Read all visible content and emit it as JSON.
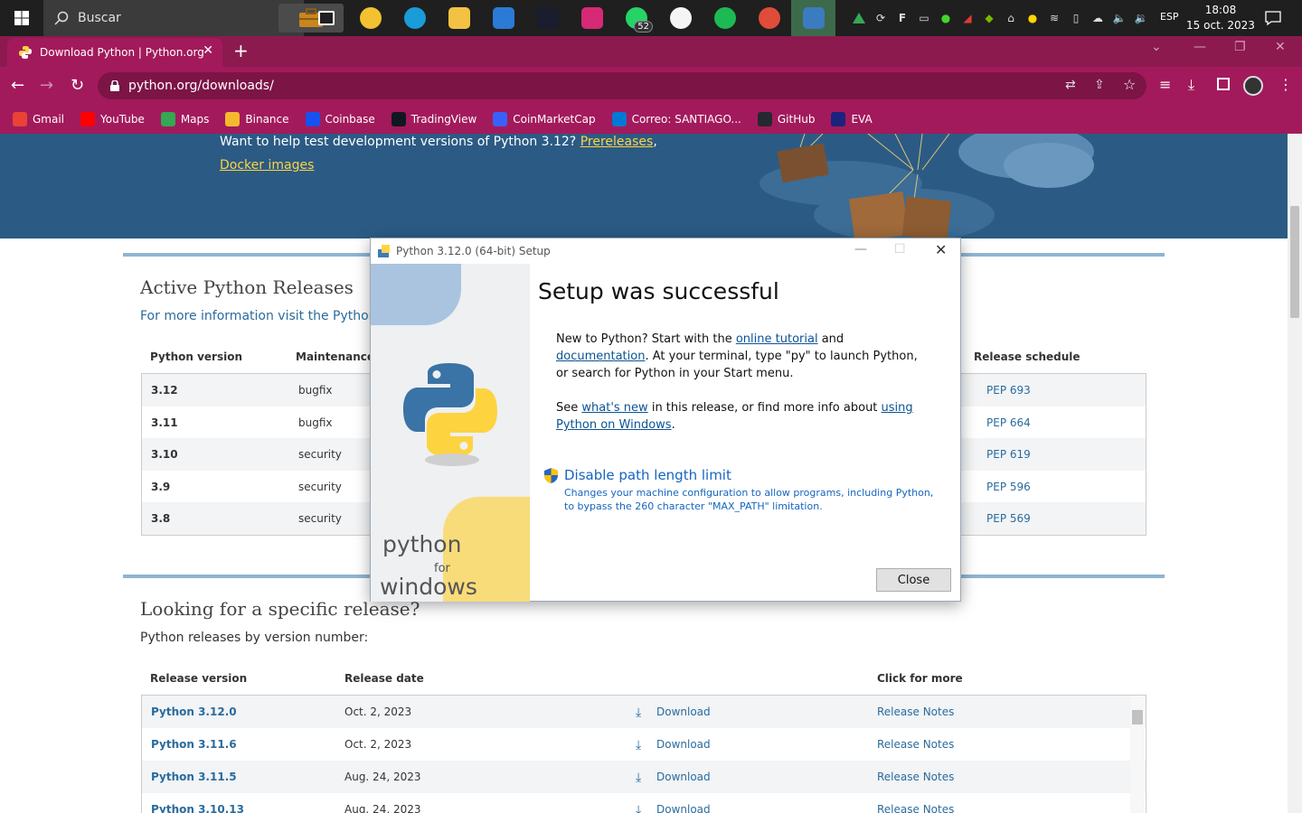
{
  "taskbar": {
    "search_placeholder": "Buscar",
    "apps": [
      {
        "name": "task-view-icon",
        "color": "#1f1f1f"
      },
      {
        "name": "chrome-icon",
        "color": "#f2c230"
      },
      {
        "name": "edge-icon",
        "color": "#1a9cd8"
      },
      {
        "name": "file-explorer-icon",
        "color": "#f4c242"
      },
      {
        "name": "store-icon",
        "color": "#2a7ad6"
      },
      {
        "name": "speedtest-icon",
        "color": "#1a1d2e"
      },
      {
        "name": "instagram-icon",
        "color": "#d62976"
      },
      {
        "name": "whatsapp-icon",
        "color": "#25d366"
      },
      {
        "name": "itunes-icon",
        "color": "#f5f5f5"
      },
      {
        "name": "spotify-icon",
        "color": "#1db954"
      },
      {
        "name": "chrome-profile-icon",
        "color": "#e04b3a"
      },
      {
        "name": "python-setup-icon",
        "color": "#3b7bbf"
      }
    ],
    "whatsapp_badge": "52",
    "language": "ESP",
    "time": "18:08",
    "date": "15 oct. 2023"
  },
  "browser": {
    "tab_title": "Download Python | Python.org",
    "url": "python.org/downloads/",
    "bookmarks": [
      {
        "label": "Gmail",
        "color": "#ea4335"
      },
      {
        "label": "YouTube",
        "color": "#ff0000"
      },
      {
        "label": "Maps",
        "color": "#34a853"
      },
      {
        "label": "Binance",
        "color": "#f3ba2f"
      },
      {
        "label": "Coinbase",
        "color": "#1652f0"
      },
      {
        "label": "TradingView",
        "color": "#131722"
      },
      {
        "label": "CoinMarketCap",
        "color": "#3861fb"
      },
      {
        "label": "Correo: SANTIAGO...",
        "color": "#0078d4"
      },
      {
        "label": "GitHub",
        "color": "#24292f"
      },
      {
        "label": "EVA",
        "color": "#1a237e"
      }
    ]
  },
  "page": {
    "hero_text": "Want to help test development versions of Python 3.12?",
    "prereleases_link": "Prereleases",
    "comma": ",",
    "docker_link": "Docker images",
    "active_title": "Active Python Releases",
    "active_sub": "For more information visit the Python",
    "active_headers": {
      "version": "Python version",
      "maintenance": "Maintenance",
      "schedule": "Release schedule"
    },
    "active_rows": [
      {
        "version": "3.12",
        "status": "bugfix",
        "pep": "PEP 693"
      },
      {
        "version": "3.11",
        "status": "bugfix",
        "pep": "PEP 664"
      },
      {
        "version": "3.10",
        "status": "security",
        "pep": "PEP 619"
      },
      {
        "version": "3.9",
        "status": "security",
        "pep": "PEP 596"
      },
      {
        "version": "3.8",
        "status": "security",
        "pep": "PEP 569"
      }
    ],
    "specific_title": "Looking for a specific release?",
    "specific_sub": "Python releases by version number:",
    "release_headers": {
      "version": "Release version",
      "date": "Release date",
      "more": "Click for more"
    },
    "releases": [
      {
        "version": "Python 3.12.0",
        "date": "Oct. 2, 2023",
        "download": "Download",
        "notes": "Release Notes"
      },
      {
        "version": "Python 3.11.6",
        "date": "Oct. 2, 2023",
        "download": "Download",
        "notes": "Release Notes"
      },
      {
        "version": "Python 3.11.5",
        "date": "Aug. 24, 2023",
        "download": "Download",
        "notes": "Release Notes"
      },
      {
        "version": "Python 3.10.13",
        "date": "Aug. 24, 2023",
        "download": "Download",
        "notes": "Release Notes"
      }
    ]
  },
  "dialog": {
    "title": "Python 3.12.0 (64-bit) Setup",
    "heading": "Setup was successful",
    "p1_a": "New to Python? Start with the",
    "p1_link1": "online tutorial",
    "p1_b": "and",
    "p1_link2": "documentation",
    "p1_c": ". At your terminal, type \"py\" to launch Python, or search for Python in your Start menu.",
    "p2_a": "See",
    "p2_link1": "what's new",
    "p2_b": "in this release, or find more info about",
    "p2_link2": "using Python on Windows",
    "p2_c": ".",
    "option_title": "Disable path length limit",
    "option_desc": "Changes your machine configuration to allow programs, including Python, to bypass the 260 character \"MAX_PATH\" limitation.",
    "side_python": "python",
    "side_for": "for",
    "side_windows": "windows",
    "close_label": "Close"
  }
}
